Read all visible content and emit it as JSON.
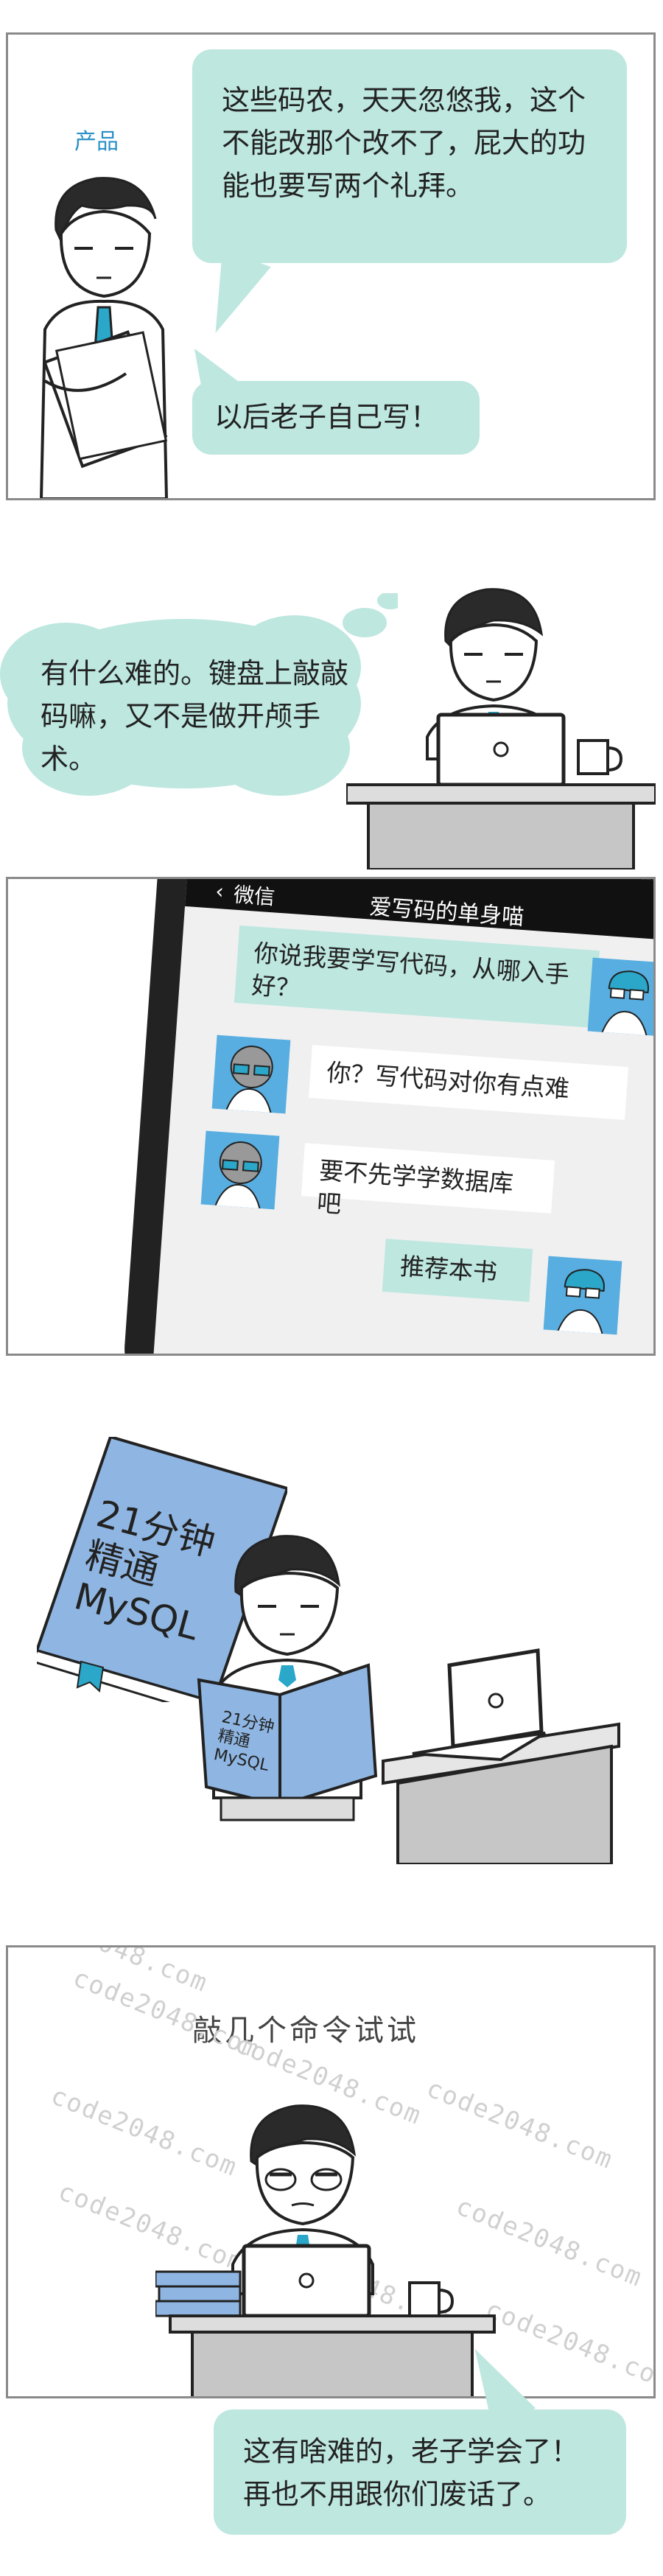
{
  "panel1": {
    "role_label": "产品",
    "bubble_top": "这些码农，天天忽悠我，这个不能改那个改不了，屁大的功能也要写两个礼拜。",
    "bubble_bottom": "以后老子自己写！"
  },
  "panel2": {
    "thought": "有什么难的。键盘上敲敲码嘛，又不是做开颅手术。"
  },
  "panel3": {
    "back_label": "微信",
    "chat_title": "爱写码的单身喵",
    "messages": [
      {
        "side": "right",
        "text": "你说我要学写代码，从哪入手好？"
      },
      {
        "side": "left",
        "text": "你？写代码对你有点难"
      },
      {
        "side": "left",
        "text": "要不先学学数据库吧"
      },
      {
        "side": "right",
        "text": "推荐本书"
      }
    ]
  },
  "panel4": {
    "book_title": "21分钟\n精通\nMySQL",
    "book_title_small": "21分钟\n精通\nMySQL"
  },
  "panel5": {
    "caption": "敲几个命令试试",
    "bubble": "这有啥难的，老子学会了！再也不用跟你们废话了。",
    "watermark": "code2048.com"
  },
  "colors": {
    "mint": "#bde7df",
    "tie_blue": "#2aa7c9",
    "border_gray": "#8a8a8a",
    "book_blue": "#8fb6e2"
  }
}
